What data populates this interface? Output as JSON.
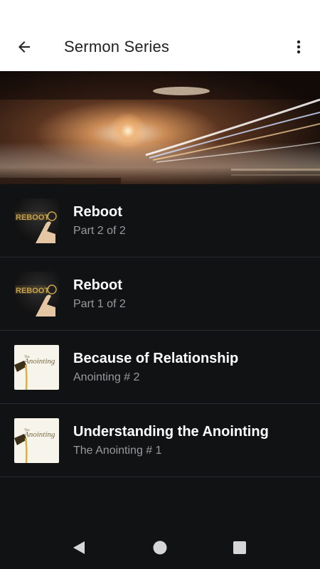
{
  "app_bar": {
    "title": "Sermon Series",
    "back_icon": "arrow-left-icon",
    "menu_icon": "more-vert-icon"
  },
  "banner": {
    "image": "night-highway-light-trails"
  },
  "sermons": [
    {
      "title": "Reboot",
      "subtitle": "Part 2 of 2",
      "thumb": "reboot",
      "thumb_text": "REBOOT"
    },
    {
      "title": "Reboot",
      "subtitle": "Part 1 of 2",
      "thumb": "reboot",
      "thumb_text": "REBOOT"
    },
    {
      "title": "Because of Relationship",
      "subtitle": "Anointing # 2",
      "thumb": "anointing",
      "thumb_text": "Anointing",
      "thumb_small": "The"
    },
    {
      "title": "Understanding the Anointing",
      "subtitle": "The Anointing # 1",
      "thumb": "anointing",
      "thumb_text": "Anointing",
      "thumb_small": "The"
    }
  ],
  "nav": {
    "back_icon": "triangle-back-icon",
    "home_icon": "circle-home-icon",
    "recents_icon": "square-recents-icon"
  },
  "colors": {
    "background": "#111214",
    "app_bar": "#ffffff",
    "title_text": "#ffffff",
    "subtitle_text": "#9a9a9d",
    "reboot_gold": "#c9a24a"
  }
}
